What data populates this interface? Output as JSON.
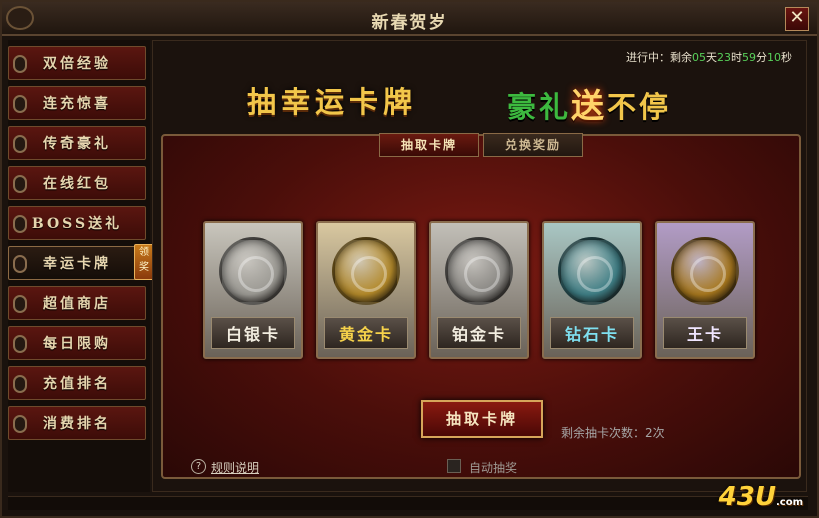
{
  "window": {
    "title": "新春贺岁",
    "close_glyph": "✕"
  },
  "sidebar": {
    "items": [
      {
        "label": "双倍经验"
      },
      {
        "label": "连充惊喜"
      },
      {
        "label": "传奇豪礼"
      },
      {
        "label": "在线红包"
      },
      {
        "label": "BOSS送礼"
      },
      {
        "label": "幸运卡牌",
        "active": true
      },
      {
        "label": "超值商店"
      },
      {
        "label": "每日限购"
      },
      {
        "label": "充值排名"
      },
      {
        "label": "消费排名"
      }
    ],
    "badge": "领奖"
  },
  "countdown": {
    "prefix": "进行中：剩余",
    "days": "05",
    "days_unit": "天",
    "hours": "23",
    "hours_unit": "时",
    "minutes": "59",
    "minutes_unit": "分",
    "seconds": "10",
    "seconds_unit": "秒"
  },
  "banner": {
    "left": "抽幸运卡牌",
    "right_1": "豪礼",
    "right_2": "送",
    "right_3": "不停"
  },
  "tabs": [
    {
      "label": "抽取卡牌",
      "active": true
    },
    {
      "label": "兑换奖励",
      "active": false
    }
  ],
  "cards": [
    {
      "name": "白银卡",
      "bg": "#c9c6bd",
      "emblem": "#9c9a94",
      "text_color": "#f2ede0",
      "icon": "silver-dragon-emblem-icon"
    },
    {
      "name": "黄金卡",
      "bg": "#d9c8a0",
      "emblem": "#b48a2a",
      "text_color": "#f6d24a",
      "icon": "gold-dragon-emblem-icon"
    },
    {
      "name": "铂金卡",
      "bg": "#c2bfb8",
      "emblem": "#8a8884",
      "text_color": "#f2ede0",
      "icon": "platinum-dragon-emblem-icon"
    },
    {
      "name": "钻石卡",
      "bg": "#a9c7c4",
      "emblem": "#3f7f86",
      "text_color": "#7fe0f0",
      "icon": "diamond-dragon-emblem-icon"
    },
    {
      "name": "王卡",
      "bg": "#b29cc6",
      "emblem": "#a8781e",
      "text_color": "#f0e6ff",
      "icon": "king-dragon-emblem-icon"
    }
  ],
  "draw_button": "抽取卡牌",
  "remaining": "剩余抽卡次数：2次",
  "help": {
    "icon": "?",
    "label": "规则说明"
  },
  "auto_draw": {
    "label": "自动抽奖",
    "checked": false
  },
  "watermark": {
    "brand": "43U",
    "domain": ".com"
  }
}
